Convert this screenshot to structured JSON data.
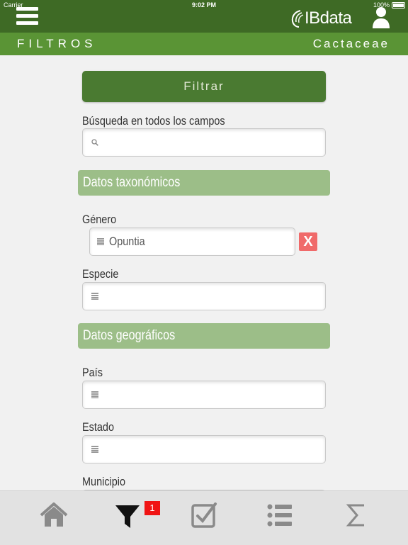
{
  "status_bar": {
    "carrier": "Carrier",
    "time": "9:02 PM",
    "battery": "100%"
  },
  "header": {
    "logo_text": "IBdata",
    "title": "FILTROS",
    "taxon": "Cactaceae"
  },
  "filter_button": {
    "label": "Filtrar"
  },
  "search": {
    "label": "Búsqueda en todos los campos",
    "value": ""
  },
  "sections": {
    "taxonomic": "Datos taxonómicos",
    "geographic": "Datos geográficos"
  },
  "fields": {
    "genero": {
      "label": "Género",
      "value": "Opuntia",
      "clear_label": "X"
    },
    "especie": {
      "label": "Especie",
      "value": ""
    },
    "pais": {
      "label": "País",
      "value": ""
    },
    "estado": {
      "label": "Estado",
      "value": ""
    },
    "municipio": {
      "label": "Municipio",
      "value": ""
    }
  },
  "tabbar": {
    "filter_badge": "1",
    "icons": [
      "home-icon",
      "filter-icon",
      "checkbox-icon",
      "list-icon",
      "sigma-icon"
    ]
  },
  "colors": {
    "header_dark": "#3e6a25",
    "header_light": "#5a9435",
    "section_bg": "#9cbe88",
    "button_bg": "#4a7a31",
    "clear_red": "#f06a6a",
    "badge_red": "#f01414"
  }
}
